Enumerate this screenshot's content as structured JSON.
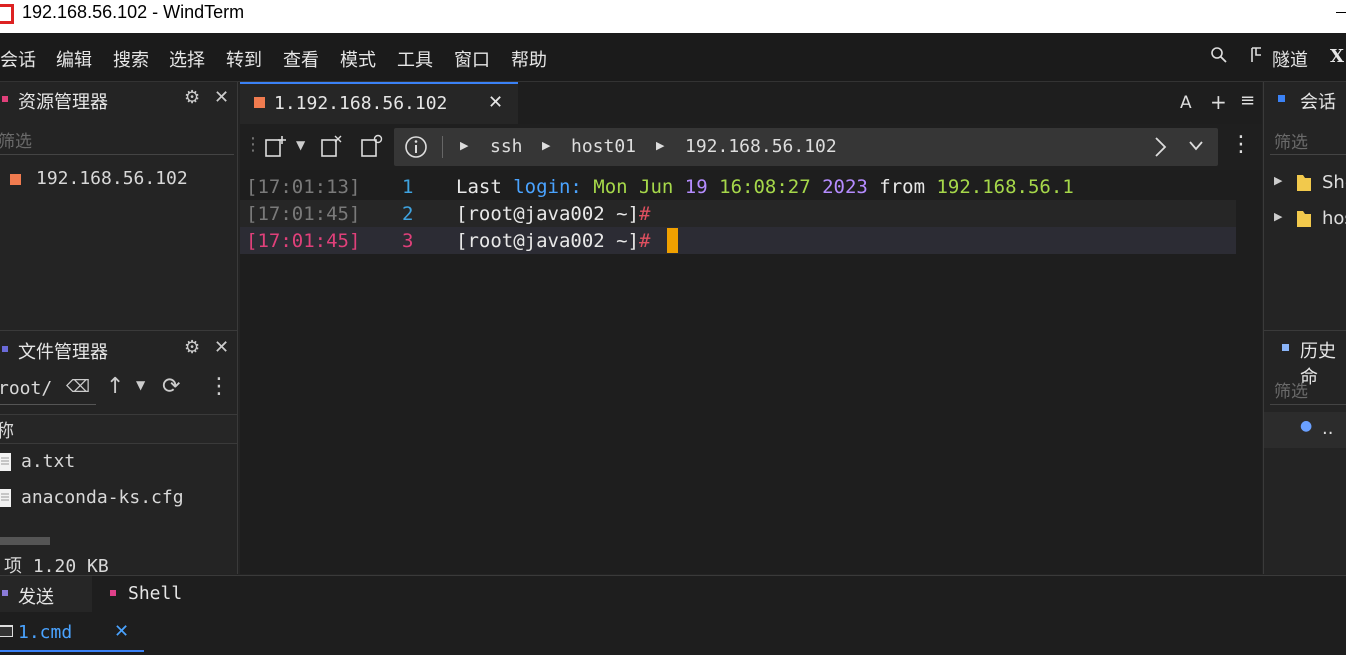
{
  "window": {
    "title": "192.168.56.102 - WindTerm"
  },
  "menu": [
    "会话",
    "编辑",
    "搜索",
    "选择",
    "转到",
    "查看",
    "模式",
    "工具",
    "窗口",
    "帮助"
  ],
  "menu_right": {
    "tunnel_label": "隧道",
    "more_label": "X"
  },
  "explorer": {
    "title": "资源管理器",
    "filter_placeholder": "筛选",
    "items": [
      "192.168.56.102"
    ]
  },
  "file_manager": {
    "title": "文件管理器",
    "path": "root/",
    "column_header": "称",
    "files": [
      "a.txt",
      "anaconda-ks.cfg"
    ],
    "status": "项 1.20 KB"
  },
  "tab": {
    "label": "1.192.168.56.102",
    "font_button": "A",
    "add_button": "+",
    "menu_button": "≡"
  },
  "address": {
    "crumbs": [
      "ssh",
      "host01",
      "192.168.56.102"
    ]
  },
  "terminal": {
    "lines": [
      {
        "time": "[17:01:13]",
        "num": "1",
        "parts": [
          "Last ",
          "login:",
          " Mon Jun ",
          "19",
          " 16:08:27 ",
          "2023",
          " from ",
          "192.168.56.1"
        ]
      },
      {
        "time": "[17:01:45]",
        "num": "2",
        "prompt": "[root@java002 ~]",
        "hash": "#"
      },
      {
        "time": "[17:01:45]",
        "num": "3",
        "prompt": "[root@java002 ~]",
        "hash": "#"
      }
    ]
  },
  "sessions_panel": {
    "title": "会话",
    "filter": "筛选",
    "items": [
      "She",
      "hos"
    ]
  },
  "history_panel": {
    "title": "历史命",
    "filter": "筛选",
    "items": [
      ".."
    ]
  },
  "bottom": {
    "send_label": "发送",
    "shell_label": "Shell",
    "cmd_tab": "1.cmd"
  },
  "colors": {
    "accent": "#3b82f6",
    "tab_square": "#f07b4f",
    "timestamp_active": "#e0407a",
    "prompt_hash": "#e05060",
    "cursor": "#f0a000",
    "green": "#a6d84a",
    "purple": "#b58cff",
    "blue_text": "#4aa3ff"
  }
}
